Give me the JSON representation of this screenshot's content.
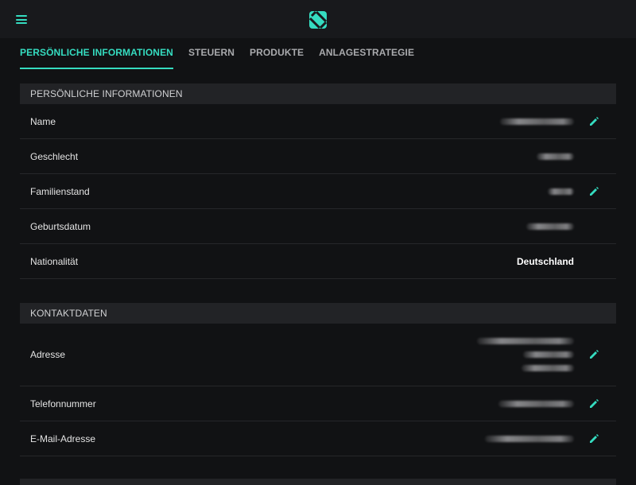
{
  "header": {
    "menu_icon": "hamburger-menu-icon",
    "logo_icon": "brand-logo-icon",
    "accent_color": "#35dcc0"
  },
  "tabs": [
    {
      "label": "PERSÖNLICHE INFORMATIONEN",
      "active": true
    },
    {
      "label": "STEUERN",
      "active": false
    },
    {
      "label": "PRODUKTE",
      "active": false
    },
    {
      "label": "ANLAGESTRATEGIE",
      "active": false
    }
  ],
  "personal": {
    "header": "PERSÖNLICHE INFORMATIONEN",
    "rows": [
      {
        "label": "Name",
        "value": "",
        "redacted": true,
        "editable": true
      },
      {
        "label": "Geschlecht",
        "value": "",
        "redacted": true,
        "editable": false
      },
      {
        "label": "Familienstand",
        "value": "",
        "redacted": true,
        "editable": true
      },
      {
        "label": "Geburtsdatum",
        "value": "",
        "redacted": true,
        "editable": false
      },
      {
        "label": "Nationalität",
        "value": "Deutschland",
        "redacted": false,
        "editable": false
      }
    ]
  },
  "contact": {
    "header": "KONTAKTDATEN",
    "rows": [
      {
        "label": "Adresse",
        "value": "",
        "redacted": true,
        "editable": true
      },
      {
        "label": "Telefonnummer",
        "value": "",
        "redacted": true,
        "editable": true
      },
      {
        "label": "E-Mail-Adresse",
        "value": "",
        "redacted": true,
        "editable": true
      }
    ]
  },
  "edit_icon": "pencil-icon"
}
